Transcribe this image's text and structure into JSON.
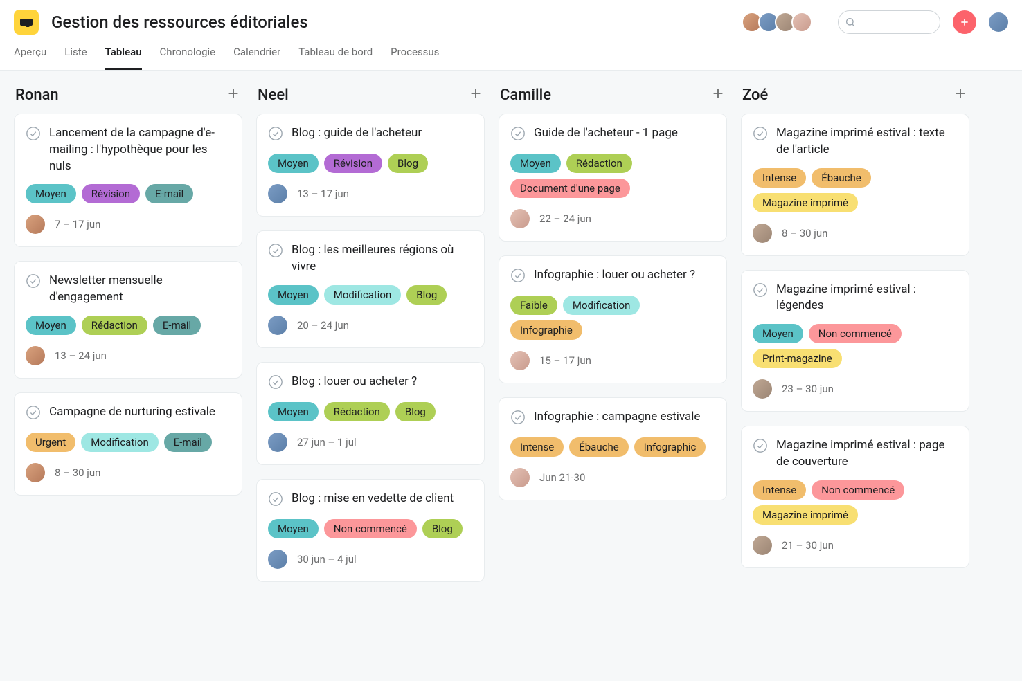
{
  "header": {
    "title": "Gestion des ressources éditoriales",
    "searchPlaceholder": ""
  },
  "tabs": [
    {
      "label": "Aperçu",
      "active": false
    },
    {
      "label": "Liste",
      "active": false
    },
    {
      "label": "Tableau",
      "active": true
    },
    {
      "label": "Chronologie",
      "active": false
    },
    {
      "label": "Calendrier",
      "active": false
    },
    {
      "label": "Tableau de bord",
      "active": false
    },
    {
      "label": "Processus",
      "active": false
    }
  ],
  "tagColors": {
    "Moyen": "c-aqua",
    "Révision": "c-purple",
    "E-mail": "c-tealgreen",
    "Rédaction": "c-yellowgreen",
    "Urgent": "c-orange",
    "Modification": "c-mint",
    "Blog": "c-yellowgreen",
    "Non commencé": "c-salmon",
    "Document d'une page": "c-salmon",
    "Faible": "c-lime",
    "Infographie": "c-orange",
    "Intense": "c-orange",
    "Ébauche": "c-orange",
    "Infographic": "c-orange",
    "Magazine imprimé": "c-yellow",
    "Print-magazine": "c-yellow"
  },
  "columns": [
    {
      "name": "Ronan",
      "avatarHue": "h1",
      "cards": [
        {
          "title": "Lancement de la campagne d'e-mailing : l'hypothèque pour les nuls",
          "tags": [
            "Moyen",
            "Révision",
            "E-mail"
          ],
          "date": "7 – 17 jun"
        },
        {
          "title": "Newsletter mensuelle d'engagement",
          "tags": [
            "Moyen",
            "Rédaction",
            "E-mail"
          ],
          "date": "13 – 24 jun"
        },
        {
          "title": "Campagne de nurturing estivale",
          "tags": [
            "Urgent",
            "Modification",
            "E-mail"
          ],
          "date": "8 – 30 jun"
        }
      ]
    },
    {
      "name": "Neel",
      "avatarHue": "h2",
      "cards": [
        {
          "title": "Blog : guide de l'acheteur",
          "tags": [
            "Moyen",
            "Révision",
            "Blog"
          ],
          "date": "13 – 17 jun"
        },
        {
          "title": "Blog : les meilleures régions où vivre",
          "tags": [
            "Moyen",
            "Modification",
            "Blog"
          ],
          "date": "20 – 24 jun"
        },
        {
          "title": "Blog : louer ou acheter ?",
          "tags": [
            "Moyen",
            "Rédaction",
            "Blog"
          ],
          "date": "27 jun  – 1 jul"
        },
        {
          "title": "Blog : mise en vedette de client",
          "tags": [
            "Moyen",
            "Non commencé",
            "Blog"
          ],
          "date": "30 jun – 4 jul"
        }
      ]
    },
    {
      "name": "Camille",
      "avatarHue": "h4",
      "cards": [
        {
          "title": "Guide de l'acheteur - 1 page",
          "tags": [
            "Moyen",
            "Rédaction",
            "Document d'une page"
          ],
          "date": "22 – 24 jun"
        },
        {
          "title": "Infographie : louer ou acheter ?",
          "tags": [
            "Faible",
            "Modification",
            "Infographie"
          ],
          "date": "15 – 17 jun"
        },
        {
          "title": "Infographie : campagne estivale",
          "tags": [
            "Intense",
            "Ébauche",
            "Infographic"
          ],
          "date": "Jun 21-30"
        }
      ]
    },
    {
      "name": "Zoé",
      "avatarHue": "h3",
      "cards": [
        {
          "title": "Magazine imprimé estival : texte de l'article",
          "tags": [
            "Intense",
            "Ébauche",
            "Magazine imprimé"
          ],
          "date": "8 – 30 jun"
        },
        {
          "title": "Magazine imprimé estival : légendes",
          "tags": [
            "Moyen",
            "Non commencé",
            "Print-magazine"
          ],
          "date": "23 – 30 jun"
        },
        {
          "title": "Magazine imprimé estival : page de couverture",
          "tags": [
            "Intense",
            "Non commencé",
            "Magazine imprimé"
          ],
          "date": "21 – 30 jun"
        }
      ]
    }
  ]
}
